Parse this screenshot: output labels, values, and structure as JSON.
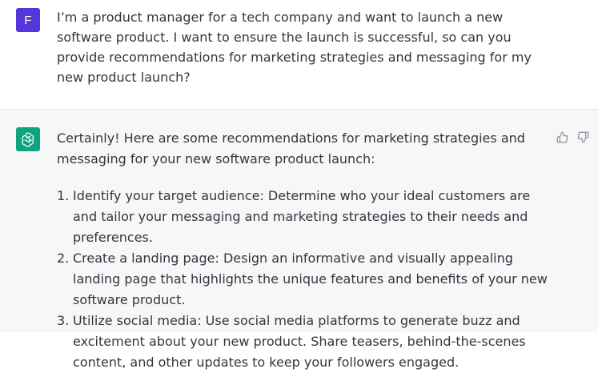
{
  "user_message": {
    "avatar_initial": "F",
    "text": "I’m a product manager for a tech company and want to launch a new software product. I want to ensure the launch is successful, so can you provide recommendations for marketing strategies and messaging for my new product launch?"
  },
  "assistant_message": {
    "intro": "Certainly! Here are some recommendations for marketing strategies and messaging for your new software product launch:",
    "items": [
      {
        "number": "1.",
        "text": "Identify your target audience: Determine who your ideal customers are and tailor your messaging and marketing strategies to their needs and preferences."
      },
      {
        "number": "2.",
        "text": "Create a landing page: Design an informative and visually appealing landing page that highlights the unique features and benefits of your new software product."
      },
      {
        "number": "3.",
        "text": "Utilize social media: Use social media platforms to generate buzz and excitement about your new product. Share teasers, behind-the-scenes content, and other updates to keep your followers engaged."
      }
    ]
  },
  "icons": {
    "assistant_avatar": "openai-logo-icon",
    "thumbs_up": "thumbs-up-icon",
    "thumbs_down": "thumbs-down-icon"
  },
  "colors": {
    "user_avatar_bg": "#5436da",
    "assistant_avatar_bg": "#10a37f",
    "assistant_block_bg": "#f7f7f8"
  }
}
